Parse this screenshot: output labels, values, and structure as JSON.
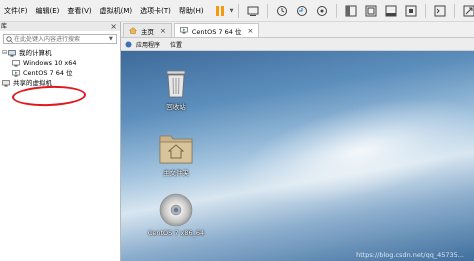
{
  "menubar": {
    "items": [
      "文件(F)",
      "编辑(E)",
      "查看(V)",
      "虚拟机(M)",
      "选项卡(T)",
      "帮助(H)"
    ]
  },
  "toolbar": {
    "icons": [
      "pause-icon",
      "send-keys-icon",
      "snapshot-icon",
      "revert-snapshot-icon",
      "snapshot-manager-icon",
      "sidebar-toggle-icon",
      "thumbnail-icon",
      "fullscreen-icon",
      "unity-icon",
      "console-icon",
      "stretch-icon"
    ],
    "accent": "#f39c12"
  },
  "library": {
    "title": "库",
    "search_placeholder": "在此处键入内容进行搜索",
    "tree": {
      "root": "我的计算机",
      "children": [
        "Windows 10 x64",
        "CentOS 7 64 位"
      ],
      "shared": "共享的虚拟机"
    },
    "highlight_color": "#e4161d"
  },
  "tabs": [
    {
      "label": "主页"
    },
    {
      "label": "CentOS 7 64 位"
    }
  ],
  "guest": {
    "menu": [
      "应用程序",
      "位置"
    ]
  },
  "desktop": {
    "icons": [
      {
        "label": "回收站"
      },
      {
        "label": "主文件夹"
      },
      {
        "label": "CentOS 7 x86_64"
      }
    ],
    "watermark": "https://blog.csdn.net/qq_45735..."
  }
}
